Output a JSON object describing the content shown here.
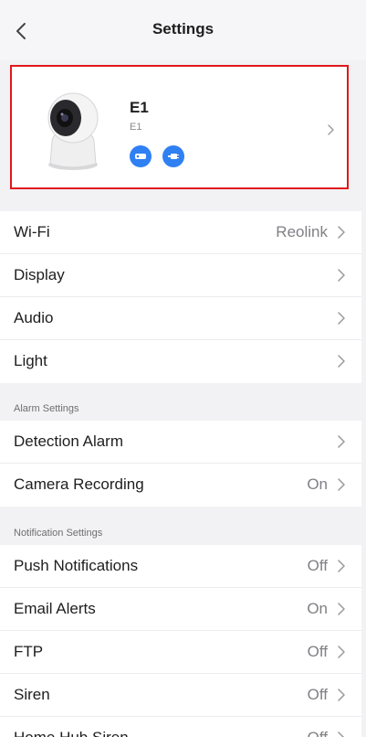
{
  "header": {
    "title": "Settings"
  },
  "device": {
    "name": "E1",
    "model": "E1"
  },
  "general_items": [
    {
      "label": "Wi-Fi",
      "value": "Reolink"
    },
    {
      "label": "Display",
      "value": ""
    },
    {
      "label": "Audio",
      "value": ""
    },
    {
      "label": "Light",
      "value": ""
    }
  ],
  "alarm_section": {
    "title": "Alarm Settings",
    "items": [
      {
        "label": "Detection Alarm",
        "value": ""
      },
      {
        "label": "Camera Recording",
        "value": "On"
      }
    ]
  },
  "notification_section": {
    "title": "Notification Settings",
    "items": [
      {
        "label": "Push Notifications",
        "value": "Off"
      },
      {
        "label": "Email Alerts",
        "value": "On"
      },
      {
        "label": "FTP",
        "value": "Off"
      },
      {
        "label": "Siren",
        "value": "Off"
      },
      {
        "label": "Home Hub Siren",
        "value": "Off"
      }
    ]
  },
  "colors": {
    "accent": "#2f80f3",
    "highlight_border": "#e0181b"
  }
}
